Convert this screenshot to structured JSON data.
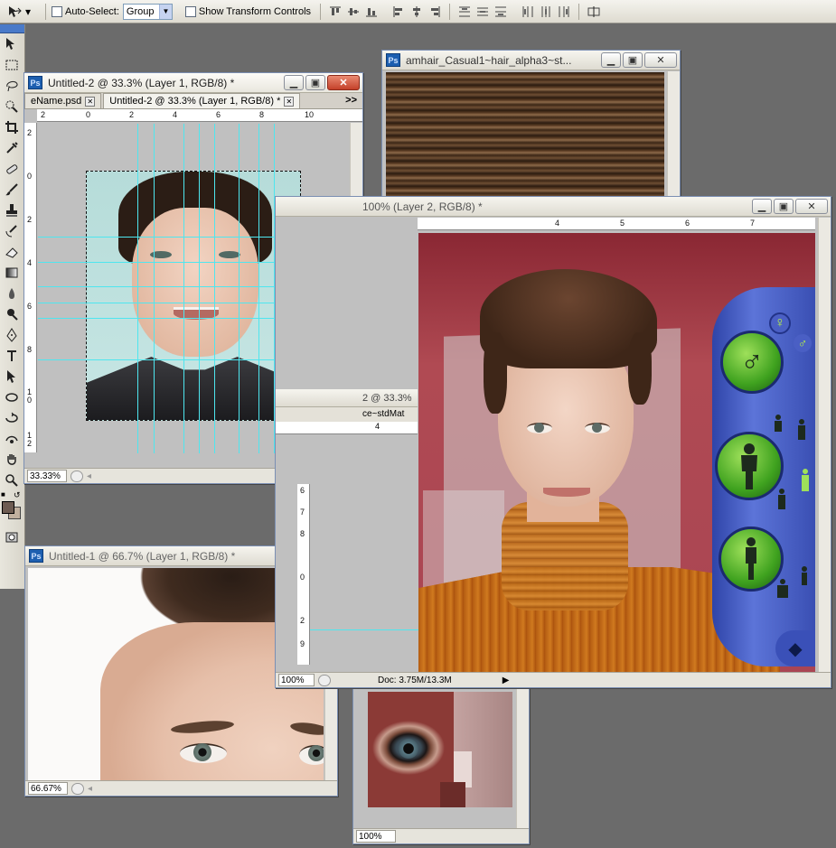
{
  "options_bar": {
    "auto_select_label": "Auto-Select:",
    "auto_select_value": "Group",
    "show_transform_label": "Show Transform Controls"
  },
  "windows": {
    "untitled2": {
      "title": "Untitled-2 @ 33.3% (Layer 1, RGB/8) *",
      "tabs": [
        "eName.psd",
        "Untitled-2 @ 33.3% (Layer 1, RGB/8) *"
      ],
      "tabs_more": ">>",
      "ruler_h": [
        "0",
        "2",
        "4",
        "6",
        "8",
        "10"
      ],
      "ruler_h_left": "2",
      "ruler_v": [
        "2",
        "0",
        "2",
        "4",
        "6",
        "8",
        "1\n0",
        "1\n2"
      ],
      "zoom": "33.33%"
    },
    "hair": {
      "title": "amhair_Casual1~hair_alpha3~st..."
    },
    "layer2": {
      "title": "100% (Layer 2, RGB/8) *",
      "ruler_h": [
        "4",
        "5",
        "6",
        "7"
      ],
      "ruler_v": [
        "6",
        "7",
        "8",
        "0",
        "2",
        "9"
      ],
      "zoom": "100%",
      "doc": "Doc: 3.75M/13.3M"
    },
    "std": {
      "title": "std",
      "title2": "2 @ 33.3%",
      "tab": "ce~stdMat",
      "ruler": "4"
    },
    "untitled1": {
      "title": "Untitled-1 @ 66.7% (Layer 1, RGB/8) *",
      "zoom": "66.67%"
    },
    "eye": {
      "zoom": "100%"
    }
  },
  "cas_panel": {
    "gender_female": "♀",
    "gender_male": "♂"
  },
  "colors": {
    "foreground": "#6e5c52",
    "background": "#c1b09e",
    "guide": "#4ee6ef"
  }
}
